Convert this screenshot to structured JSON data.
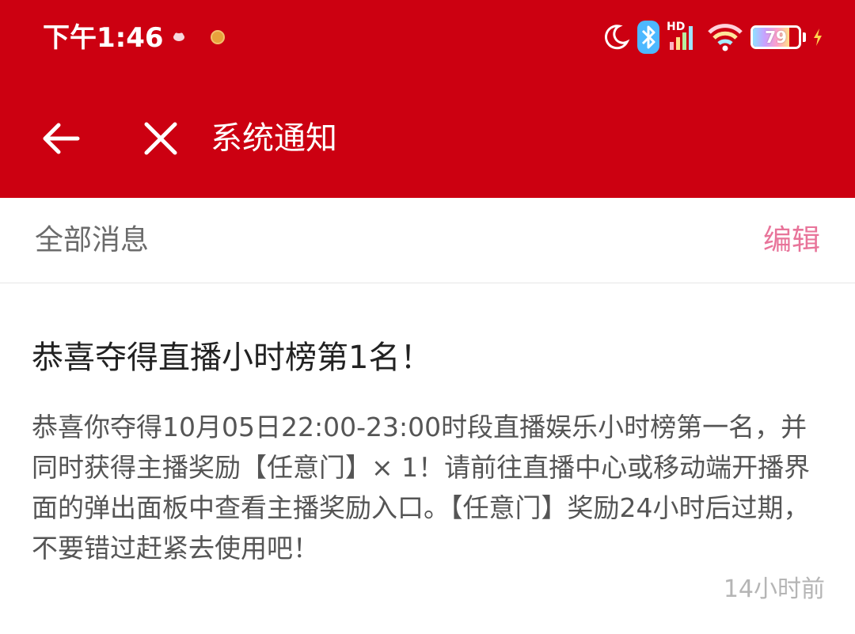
{
  "status_bar": {
    "time": "下午1:46",
    "battery": "79",
    "network_badge": "HD",
    "icons": [
      "app-notify-icon",
      "coin-icon",
      "moon-icon",
      "bluetooth-icon",
      "signal-icon",
      "wifi-icon",
      "battery-icon",
      "charging-icon"
    ]
  },
  "toolbar": {
    "title": "系统通知",
    "back_icon": "arrow-left-icon",
    "close_icon": "close-icon"
  },
  "filter_bar": {
    "label": "全部消息",
    "edit_label": "编辑"
  },
  "notice": {
    "title": "恭喜夺得直播小时榜第1名！",
    "body": "恭喜你夺得10月05日22:00-23:00时段直播娱乐小时榜第一名，并同时获得主播奖励【任意门】× 1！请前往直播中心或移动端开播界面的弹出面板中查看主播奖励入口。【任意门】奖励24小时后过期，不要错过赶紧去使用吧！",
    "time": "14小时前"
  },
  "colors": {
    "header": "#cc0011",
    "edit_accent": "#e8749a"
  }
}
